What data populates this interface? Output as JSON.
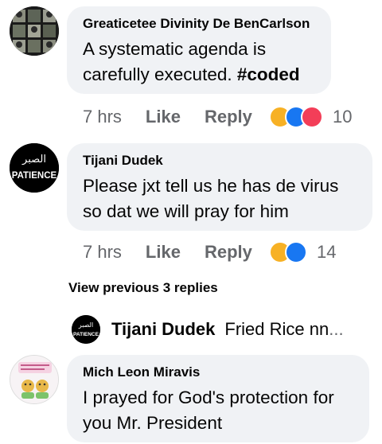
{
  "comments": [
    {
      "author": "Greaticetee Divinity De BenCarlson",
      "text": "A systematic agenda is carefully executed. ",
      "hashtag": "#coded",
      "time": "7 hrs",
      "like_label": "Like",
      "reply_label": "Reply",
      "reactions": [
        "haha",
        "like",
        "love"
      ],
      "reaction_count": "10",
      "avatar_icon": "grid-photo-avatar"
    },
    {
      "author": "Tijani Dudek",
      "text": "Please jxt tell us he has de virus so dat we will pray for him",
      "time": "7 hrs",
      "like_label": "Like",
      "reply_label": "Reply",
      "reactions": [
        "haha",
        "like"
      ],
      "reaction_count": "14",
      "avatar_icon": "patience-logo-avatar",
      "avatar_arabic": "الصبر",
      "avatar_word": "PATIENCE"
    },
    {
      "author": "Mich Leon Miravis",
      "text": "I prayed for God's protection for you Mr. President",
      "avatar_icon": "cartoon-card-avatar"
    }
  ],
  "view_previous": "View previous 3 replies",
  "reply_preview": {
    "author": "Tijani Dudek",
    "snippet": "Fried Rice nn",
    "ellipsis": "..."
  },
  "colors": {
    "bubble": "#f0f2f5",
    "meta": "#65676b",
    "haha": "#f7b125",
    "like": "#1877f2",
    "love": "#f33e58"
  }
}
